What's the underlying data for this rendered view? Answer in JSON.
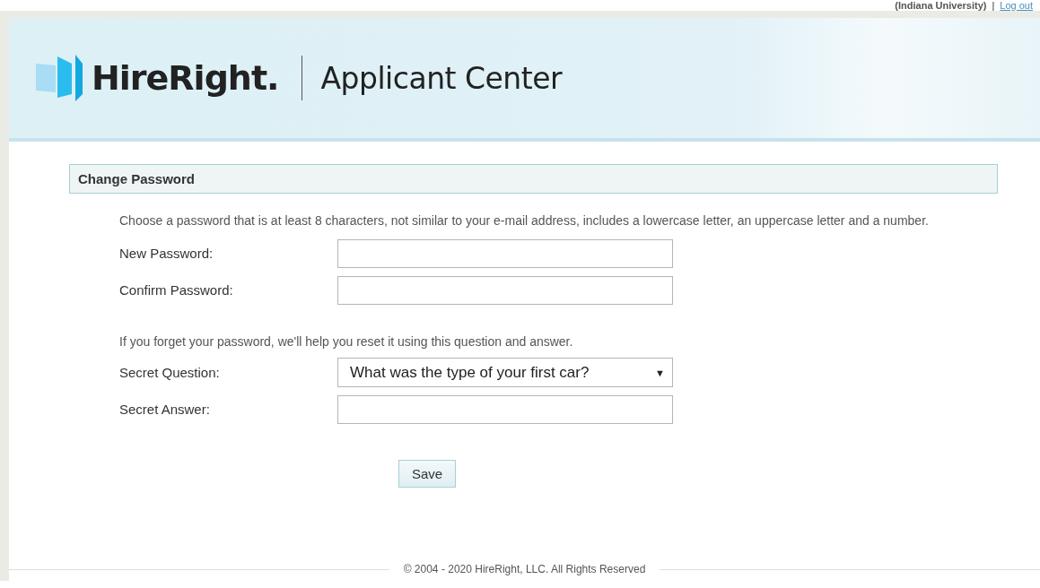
{
  "top_bar": {
    "organization": "(Indiana University)",
    "separator": "|",
    "logout_link": "Log out"
  },
  "header": {
    "brand": "HireRight.",
    "product": "Applicant Center"
  },
  "panel": {
    "title": "Change Password",
    "intro": "Choose a password that is at least 8 characters, not similar to your e-mail address, includes a lowercase letter, an uppercase letter and a number.",
    "password_fields": [
      {
        "label": "New Password:"
      },
      {
        "label": "Confirm Password:"
      }
    ],
    "security_note": "If you forget your password, we'll help you reset it using this question and answer.",
    "secret_question": {
      "label": "Secret Question:",
      "value": "What was the type of your first car?",
      "arrow": "▼"
    },
    "secret_answer": {
      "label": "Secret Answer:"
    },
    "save_button": "Save"
  },
  "footer": "© 2004 - 2020 HireRight, LLC. All Rights Reserved"
}
